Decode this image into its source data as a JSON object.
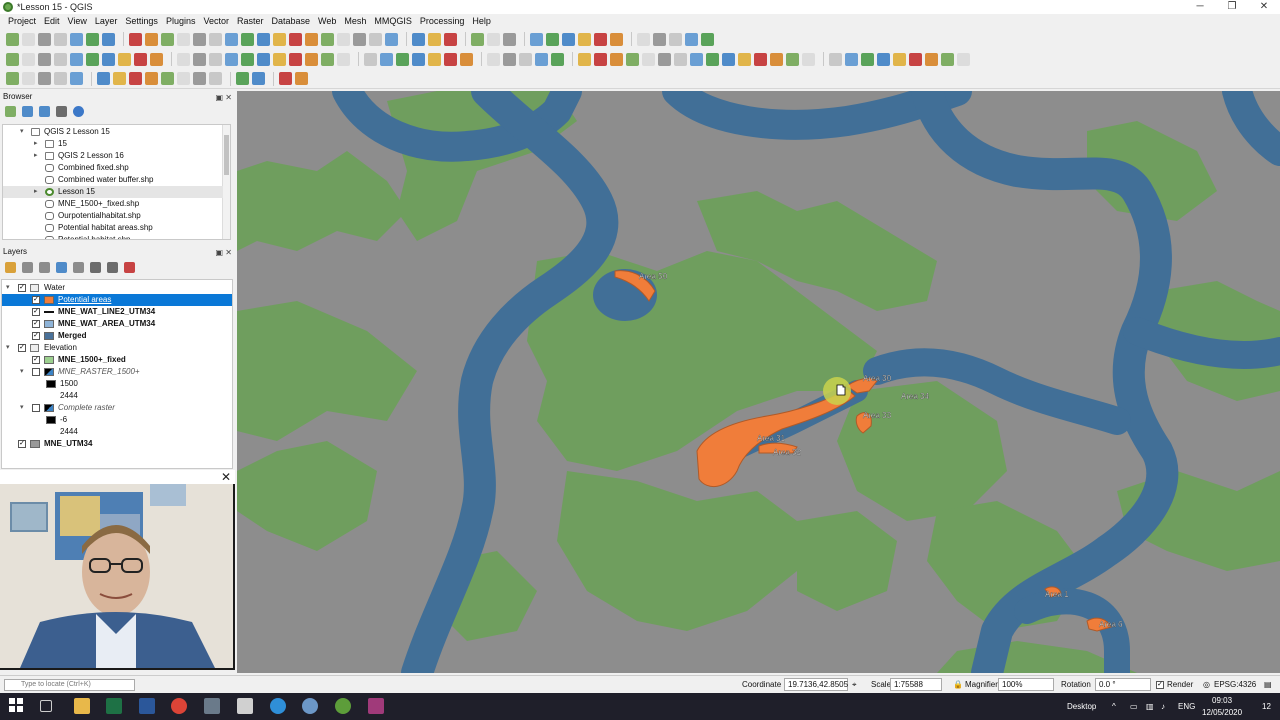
{
  "window": {
    "title": "*Lesson 15 - QGIS",
    "minimize": "─",
    "maximize": "❐",
    "close": "✕"
  },
  "menu": [
    "Project",
    "Edit",
    "View",
    "Layer",
    "Settings",
    "Plugins",
    "Vector",
    "Raster",
    "Database",
    "Web",
    "Mesh",
    "MMQGIS",
    "Processing",
    "Help"
  ],
  "browser": {
    "title": "Browser",
    "items": [
      {
        "label": "QGIS 2 Lesson 15",
        "icon": "folder-icon",
        "indent": 0,
        "arrow": "▾"
      },
      {
        "label": "15",
        "icon": "folder-icon",
        "indent": 1,
        "arrow": "▸"
      },
      {
        "label": "QGIS 2 Lesson 16",
        "icon": "folder-icon",
        "indent": 1,
        "arrow": "▸"
      },
      {
        "label": "Combined fixed.shp",
        "icon": "shapefile-icon",
        "indent": 1,
        "arrow": ""
      },
      {
        "label": "Combined water buffer.shp",
        "icon": "shapefile-icon",
        "indent": 1,
        "arrow": ""
      },
      {
        "label": "Lesson 15",
        "icon": "qgis-project-icon",
        "indent": 1,
        "arrow": "▸"
      },
      {
        "label": "MNE_1500+_fixed.shp",
        "icon": "shapefile-icon",
        "indent": 1,
        "arrow": ""
      },
      {
        "label": "Ourpotentialhabitat.shp",
        "icon": "shapefile-icon",
        "indent": 1,
        "arrow": ""
      },
      {
        "label": "Potential habitat areas.shp",
        "icon": "shapefile-icon",
        "indent": 1,
        "arrow": ""
      },
      {
        "label": "Potential habitat.shp",
        "icon": "shapefile-icon",
        "indent": 1,
        "arrow": ""
      }
    ]
  },
  "layers": {
    "title": "Layers",
    "rows": [
      {
        "label": "Water",
        "type": "group",
        "indent": 0,
        "checked": true,
        "arrow": "▾",
        "selected": false,
        "bold": false,
        "italic": false
      },
      {
        "label": "Potential areas",
        "type": "fill",
        "color": "#f07d3a",
        "indent": 1,
        "checked": true,
        "arrow": "",
        "selected": true,
        "bold": false,
        "italic": false
      },
      {
        "label": "MNE_WAT_LINE2_UTM34",
        "type": "line",
        "color": "#111111",
        "indent": 1,
        "checked": true,
        "arrow": "",
        "selected": false,
        "bold": true,
        "italic": false
      },
      {
        "label": "MNE_WAT_AREA_UTM34",
        "type": "fill",
        "color": "#8fb4d8",
        "indent": 1,
        "checked": true,
        "arrow": "",
        "selected": false,
        "bold": true,
        "italic": false
      },
      {
        "label": "Merged",
        "type": "fill",
        "color": "#4a7199",
        "indent": 1,
        "checked": true,
        "arrow": "",
        "selected": false,
        "bold": true,
        "italic": false
      },
      {
        "label": "Elevation",
        "type": "group",
        "indent": 0,
        "checked": true,
        "arrow": "▾",
        "selected": false,
        "bold": false,
        "italic": false
      },
      {
        "label": "MNE_1500+_fixed",
        "type": "fill",
        "color": "#9cd08f",
        "indent": 1,
        "checked": true,
        "arrow": "",
        "selected": false,
        "bold": true,
        "italic": false
      },
      {
        "label": "MNE_RASTER_1500+",
        "type": "raster",
        "indent": 1,
        "checked": false,
        "arrow": "▾",
        "selected": false,
        "bold": false,
        "italic": true
      },
      {
        "label": "1500",
        "type": "legend-black",
        "indent": 2,
        "checked": null,
        "arrow": "",
        "selected": false,
        "bold": false,
        "italic": false
      },
      {
        "label": "2444",
        "type": "legend-none",
        "indent": 2,
        "checked": null,
        "arrow": "",
        "selected": false,
        "bold": false,
        "italic": false
      },
      {
        "label": "Complete raster",
        "type": "raster",
        "indent": 1,
        "checked": false,
        "arrow": "▾",
        "selected": false,
        "bold": false,
        "italic": true
      },
      {
        "label": "-6",
        "type": "legend-black",
        "indent": 2,
        "checked": null,
        "arrow": "",
        "selected": false,
        "bold": false,
        "italic": false
      },
      {
        "label": "2444",
        "type": "legend-none",
        "indent": 2,
        "checked": null,
        "arrow": "",
        "selected": false,
        "bold": false,
        "italic": false
      },
      {
        "label": "MNE_UTM34",
        "type": "fill",
        "color": "#999999",
        "indent": 0,
        "checked": true,
        "arrow": "",
        "selected": false,
        "bold": true,
        "italic": false
      }
    ]
  },
  "map": {
    "colors": {
      "background": "#8d8d8d",
      "land": "#6f9e5e",
      "water": "#416f97",
      "water_edge": "#5f86a8",
      "habitat": "#f07d3a",
      "highlight": "#c9d24c"
    },
    "labels": [
      "Area 50",
      "Area 30",
      "Area 34",
      "Area 33",
      "Area 31",
      "Area 32",
      "Area 1",
      "Area 6"
    ]
  },
  "status": {
    "locate_placeholder": "Type to locate (Ctrl+K)",
    "coordinate_label": "Coordinate",
    "coordinate_value": "19.7136,42.8505",
    "scale_label": "Scale",
    "scale_value": "1:75588",
    "magnifier_label": "Magnifier",
    "magnifier_value": "100%",
    "rotation_label": "Rotation",
    "rotation_value": "0.0 °",
    "render_label": "Render",
    "crs": "EPSG:4326"
  },
  "taskbar": {
    "desktop": "Desktop",
    "lang": "ENG",
    "time": "09:03",
    "date": "12/05/2020",
    "notifications": "12"
  }
}
